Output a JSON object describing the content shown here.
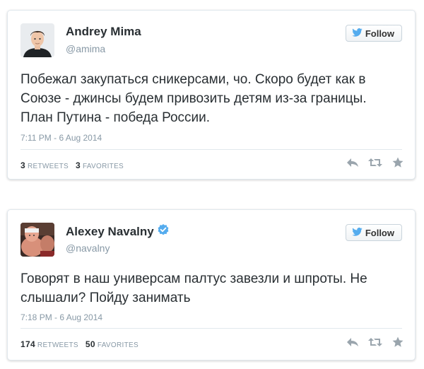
{
  "tweets": [
    {
      "author_name": "Andrey Mima",
      "handle": "@amima",
      "verified": false,
      "follow_label": "Follow",
      "text": "Побежал закупаться сникерсами, чо. Скоро будет как в Союзе - джинсы будем привозить детям из-за границы. План Путина - победа России.",
      "timestamp": "7:11 PM - 6 Aug 2014",
      "retweets": "3",
      "retweets_label": "RETWEETS",
      "favorites": "3",
      "favorites_label": "FAVORITES",
      "icons": [
        "avatar-photo",
        "twitter-bird-icon",
        "reply-icon",
        "retweet-icon",
        "favorite-star-icon"
      ]
    },
    {
      "author_name": "Alexey Navalny",
      "handle": "@navalny",
      "verified": true,
      "follow_label": "Follow",
      "text": "Говорят в наш универсам палтус завезли и шпроты. Не слышали? Пойду занимать",
      "timestamp": "7:18 PM - 6 Aug 2014",
      "retweets": "174",
      "retweets_label": "RETWEETS",
      "favorites": "50",
      "favorites_label": "FAVORITES",
      "icons": [
        "avatar-photo",
        "verified-badge-icon",
        "twitter-bird-icon",
        "reply-icon",
        "retweet-icon",
        "favorite-star-icon"
      ]
    }
  ],
  "colors": {
    "verified": "#55acee",
    "twitter_blue": "#55acee",
    "text": "#292f33",
    "muted": "#8899a6",
    "border": "#e1e8ed"
  }
}
